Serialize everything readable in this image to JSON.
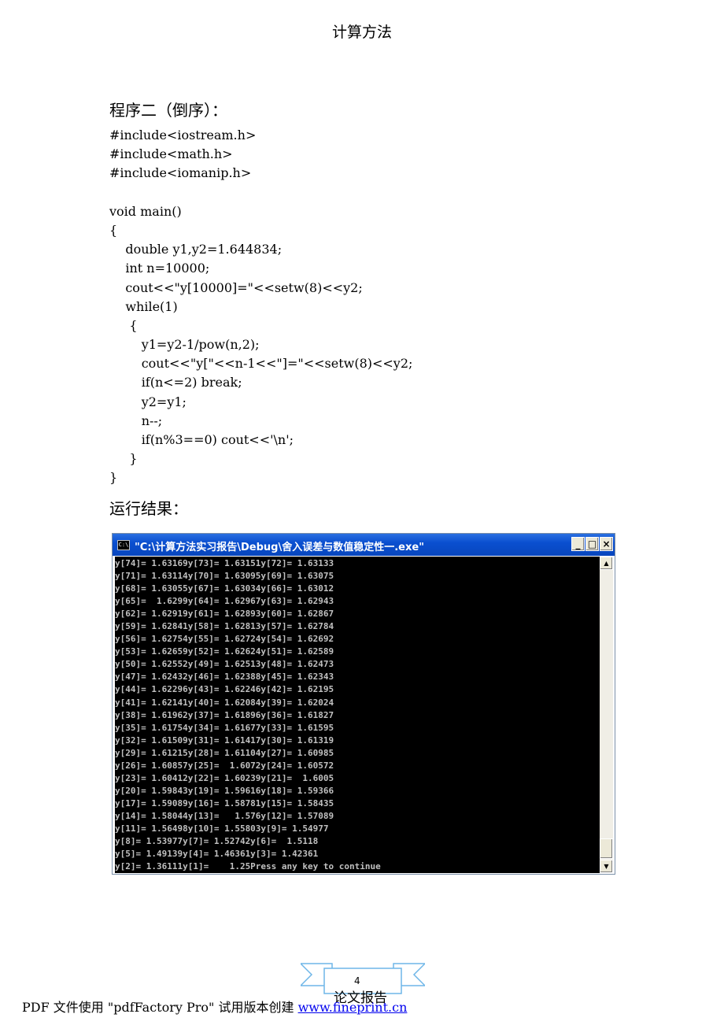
{
  "header": {
    "title": "计算方法"
  },
  "section_program": {
    "heading": "程序二（倒序）："
  },
  "code": {
    "lines": [
      "#include<iostream.h>",
      "#include<math.h>",
      "#include<iomanip.h>",
      "",
      "void main()",
      "{",
      "    double y1,y2=1.644834;",
      "    int n=10000;",
      "    cout<<\"y[10000]=\"<<setw(8)<<y2;",
      "    while(1)",
      "     {",
      "        y1=y2-1/pow(n,2);",
      "        cout<<\"y[\"<<n-1<<\"]=\"<<setw(8)<<y2;",
      "        if(n<=2) break;",
      "        y2=y1;",
      "        n--;",
      "        if(n%3==0) cout<<'\\n';",
      "     }",
      "}"
    ]
  },
  "section_results": {
    "heading": "运行结果："
  },
  "console": {
    "icon_label": "C:\\",
    "title": "\"C:\\计算方法实习报告\\Debug\\舍入误差与数值稳定性一.exe\"",
    "buttons": {
      "minimize": "_",
      "maximize": "□",
      "close": "×"
    },
    "scroll_up": "▲",
    "scroll_down": "▼",
    "lines": [
      "y[74]= 1.63169y[73]= 1.63151y[72]= 1.63133",
      "y[71]= 1.63114y[70]= 1.63095y[69]= 1.63075",
      "y[68]= 1.63055y[67]= 1.63034y[66]= 1.63012",
      "y[65]=  1.6299y[64]= 1.62967y[63]= 1.62943",
      "y[62]= 1.62919y[61]= 1.62893y[60]= 1.62867",
      "y[59]= 1.62841y[58]= 1.62813y[57]= 1.62784",
      "y[56]= 1.62754y[55]= 1.62724y[54]= 1.62692",
      "y[53]= 1.62659y[52]= 1.62624y[51]= 1.62589",
      "y[50]= 1.62552y[49]= 1.62513y[48]= 1.62473",
      "y[47]= 1.62432y[46]= 1.62388y[45]= 1.62343",
      "y[44]= 1.62296y[43]= 1.62246y[42]= 1.62195",
      "y[41]= 1.62141y[40]= 1.62084y[39]= 1.62024",
      "y[38]= 1.61962y[37]= 1.61896y[36]= 1.61827",
      "y[35]= 1.61754y[34]= 1.61677y[33]= 1.61595",
      "y[32]= 1.61509y[31]= 1.61417y[30]= 1.61319",
      "y[29]= 1.61215y[28]= 1.61104y[27]= 1.60985",
      "y[26]= 1.60857y[25]=  1.6072y[24]= 1.60572",
      "y[23]= 1.60412y[22]= 1.60239y[21]=  1.6005",
      "y[20]= 1.59843y[19]= 1.59616y[18]= 1.59366",
      "y[17]= 1.59089y[16]= 1.58781y[15]= 1.58435",
      "y[14]= 1.58044y[13]=   1.576y[12]= 1.57089",
      "y[11]= 1.56498y[10]= 1.55803y[9]= 1.54977",
      "y[8]= 1.53977y[7]= 1.52742y[6]=  1.5118",
      "y[5]= 1.49139y[4]= 1.46361y[3]= 1.42361",
      "y[2]= 1.36111y[1]=    1.25Press any key to continue"
    ]
  },
  "footer": {
    "page_number": "4",
    "ribbon_label": "论文报告",
    "pdf_notice": "PDF 文件使用 \"pdfFactory Pro\" 试用版本创建 ",
    "link_text": "www.fineprint.cn"
  },
  "colors": {
    "titlebar": "#0a4fd0",
    "console_bg": "#000000",
    "console_text": "#c0c0c0",
    "link": "#0000ee",
    "ribbon": "#6fb6e8"
  }
}
